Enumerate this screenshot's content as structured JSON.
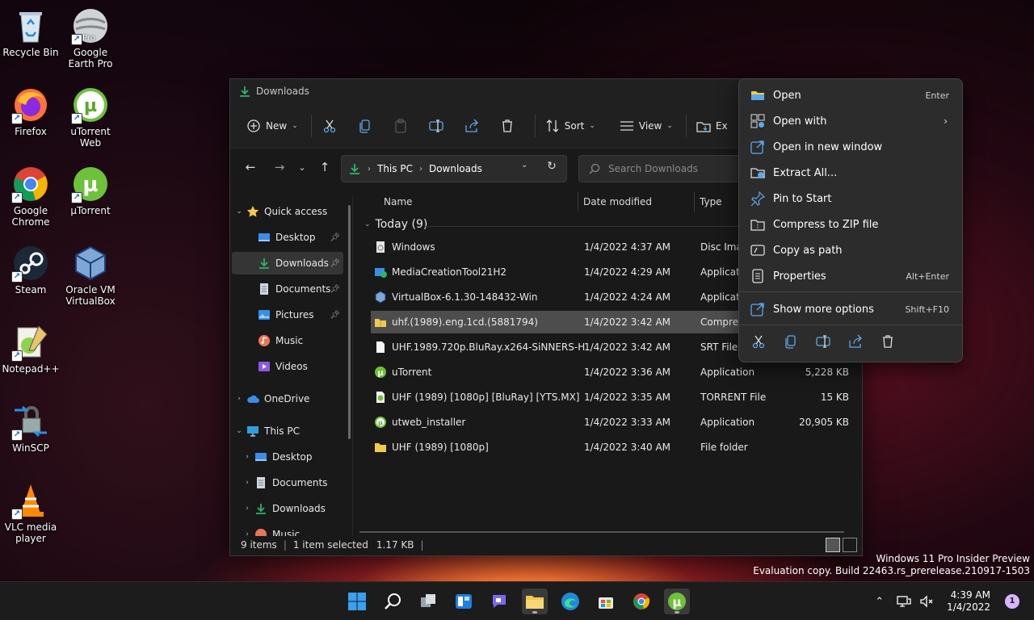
{
  "desktop": {
    "icons": [
      {
        "label": "Recycle Bin"
      },
      {
        "label": "Google Earth Pro"
      },
      {
        "label": "Firefox"
      },
      {
        "label": "uTorrent Web"
      },
      {
        "label": "Google Chrome"
      },
      {
        "label": "µTorrent"
      },
      {
        "label": "Steam"
      },
      {
        "label": "Oracle VM VirtualBox"
      },
      {
        "label": "Notepad++"
      },
      {
        "label": "WinSCP"
      },
      {
        "label": "VLC media player"
      }
    ],
    "google_earth_badge": "Pro"
  },
  "explorer": {
    "title": "Downloads",
    "toolbar": {
      "new_label": "New",
      "sort_label": "Sort",
      "view_label": "View",
      "extract_label": "Ex"
    },
    "address": {
      "crumbs": [
        "This PC",
        "Downloads"
      ]
    },
    "search": {
      "placeholder": "Search Downloads"
    },
    "sidebar": {
      "items": [
        {
          "label": "Quick access"
        },
        {
          "label": "Desktop"
        },
        {
          "label": "Downloads"
        },
        {
          "label": "Documents"
        },
        {
          "label": "Pictures"
        },
        {
          "label": "Music"
        },
        {
          "label": "Videos"
        },
        {
          "label": "OneDrive"
        },
        {
          "label": "This PC"
        },
        {
          "label": "Desktop"
        },
        {
          "label": "Documents"
        },
        {
          "label": "Downloads"
        },
        {
          "label": "Music"
        }
      ]
    },
    "columns": {
      "name": "Name",
      "date": "Date modified",
      "type": "Type"
    },
    "group": {
      "label": "Today (9)"
    },
    "files": [
      {
        "name": "Windows",
        "date": "1/4/2022 4:37 AM",
        "type": "Disc Imag",
        "size": ""
      },
      {
        "name": "MediaCreationTool21H2",
        "date": "1/4/2022 4:29 AM",
        "type": "Applicati",
        "size": ""
      },
      {
        "name": "VirtualBox-6.1.30-148432-Win",
        "date": "1/4/2022 4:24 AM",
        "type": "Applicati",
        "size": ""
      },
      {
        "name": "uhf.(1989).eng.1cd.(5881794)",
        "date": "1/4/2022 3:42 AM",
        "type": "Compres",
        "size": ""
      },
      {
        "name": "UHF.1989.720p.BluRay.x264-SiNNERS-HI....",
        "date": "1/4/2022 3:42 AM",
        "type": "SRT File",
        "size": ""
      },
      {
        "name": "uTorrent",
        "date": "1/4/2022 3:36 AM",
        "type": "Application",
        "size": "5,228 KB"
      },
      {
        "name": "UHF (1989) [1080p] [BluRay] [YTS.MX]",
        "date": "1/4/2022 3:35 AM",
        "type": "TORRENT File",
        "size": "15 KB"
      },
      {
        "name": "utweb_installer",
        "date": "1/4/2022 3:33 AM",
        "type": "Application",
        "size": "20,905 KB"
      },
      {
        "name": "UHF (1989) [1080p]",
        "date": "1/4/2022 3:40 AM",
        "type": "File folder",
        "size": ""
      }
    ],
    "status": {
      "count": "9 items",
      "selected": "1 item selected",
      "size": "1.17 KB"
    }
  },
  "context_menu": {
    "items": [
      {
        "label": "Open",
        "shortcut": "Enter"
      },
      {
        "label": "Open with",
        "shortcut": ""
      },
      {
        "label": "Open in new window",
        "shortcut": ""
      },
      {
        "label": "Extract All...",
        "shortcut": ""
      },
      {
        "label": "Pin to Start",
        "shortcut": ""
      },
      {
        "label": "Compress to ZIP file",
        "shortcut": ""
      },
      {
        "label": "Copy as path",
        "shortcut": ""
      },
      {
        "label": "Properties",
        "shortcut": "Alt+Enter"
      },
      {
        "label": "Show more options",
        "shortcut": "Shift+F10"
      }
    ]
  },
  "watermark": {
    "line1": "Windows 11 Pro Insider Preview",
    "line2": "Evaluation copy. Build 22463.rs_prerelease.210917-1503"
  },
  "taskbar": {
    "time": "4:39 AM",
    "date": "1/4/2022",
    "notification_count": "1"
  },
  "colors": {
    "accent_green": "#2fb36b",
    "folder_yellow": "#f2c94c",
    "selection": "#4d4d4d",
    "menu_bg": "#2c2c2c"
  }
}
